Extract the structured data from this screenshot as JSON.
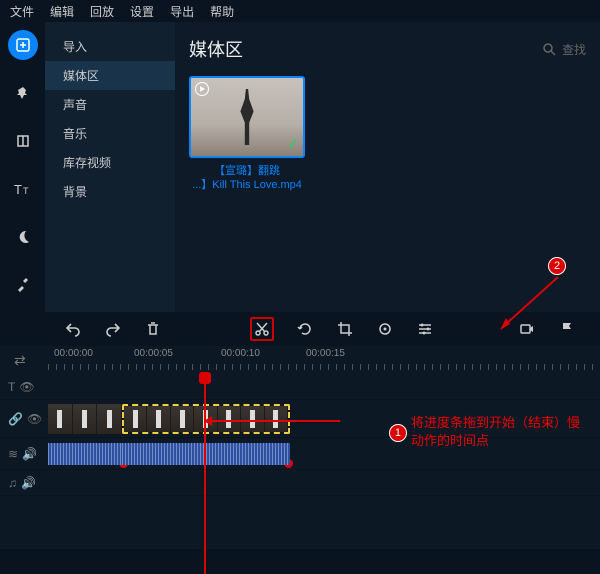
{
  "menu": {
    "file": "文件",
    "edit": "编辑",
    "playback": "回放",
    "settings": "设置",
    "export": "导出",
    "help": "帮助"
  },
  "sidebar": {
    "import": "导入",
    "media": "媒体区",
    "voice": "声音",
    "music": "音乐",
    "stock": "库存视频",
    "background": "背景"
  },
  "main": {
    "title": "媒体区",
    "search_placeholder": "查找"
  },
  "clip": {
    "line1": "【宣璐】翻跳",
    "line2": "...】Kill This Love.mp4"
  },
  "ruler": {
    "t00": "00:00:00",
    "t05": "00:00:05",
    "t10": "00:00:10",
    "t15": "00:00:15"
  },
  "markers": {
    "n1": "1",
    "n2": "2"
  },
  "annotation": {
    "l1": "将进度条拖到开始（结束）慢",
    "l2": "动作的时间点"
  }
}
